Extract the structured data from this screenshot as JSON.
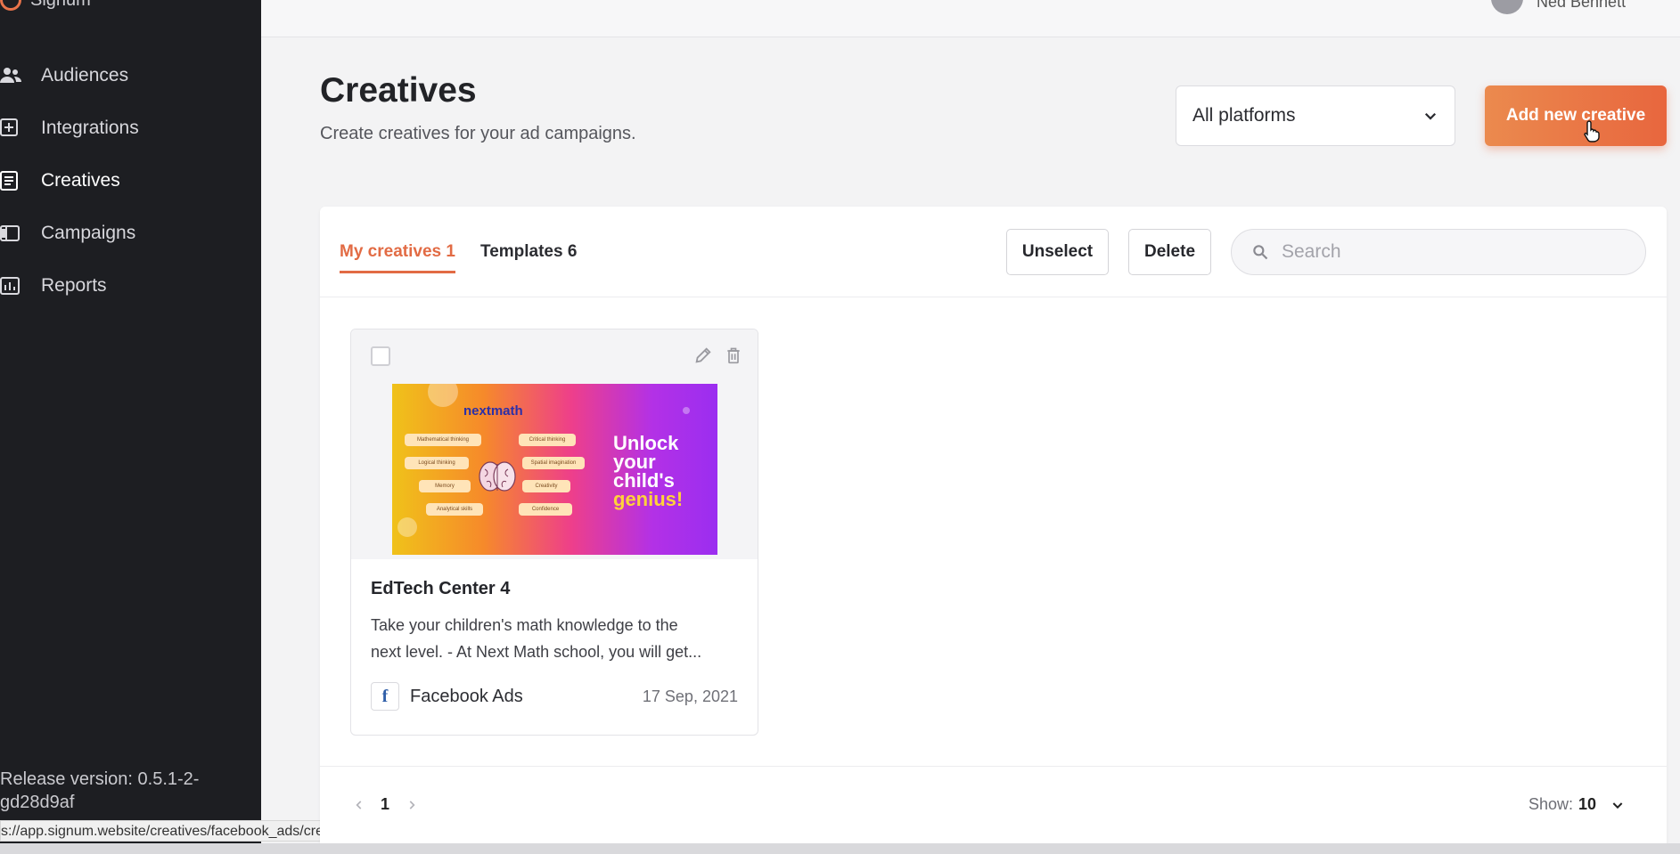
{
  "app": {
    "logo_text": "Signum"
  },
  "sidebar": {
    "items": [
      {
        "label": "Audiences",
        "icon": "users-icon"
      },
      {
        "label": "Integrations",
        "icon": "plus-square-icon"
      },
      {
        "label": "Creatives",
        "icon": "document-list-icon",
        "active": true
      },
      {
        "label": "Campaigns",
        "icon": "layout-icon"
      },
      {
        "label": "Reports",
        "icon": "bar-chart-icon"
      }
    ],
    "release_version": "Release version: 0.5.1-2-gd28d9af"
  },
  "status_bar": {
    "url": "s://app.signum.website/creatives/facebook_ads/create"
  },
  "topbar": {
    "user_name": "Ned Bennett"
  },
  "header": {
    "title": "Creatives",
    "subtitle": "Create creatives for your ad campaigns.",
    "platform_select_value": "All platforms",
    "add_button_label": "Add new creative"
  },
  "panel": {
    "tabs": [
      {
        "label": "My creatives 1",
        "active": true
      },
      {
        "label": "Templates 6",
        "active": false
      }
    ],
    "unselect_label": "Unselect",
    "delete_label": "Delete",
    "search_placeholder": "Search"
  },
  "creative_card": {
    "thumbnail": {
      "brand": "nextmath",
      "headline_line1": "Unlock",
      "headline_line2": "your",
      "headline_line3": "child's",
      "headline_line4": "genius!",
      "pills": [
        "Mathematical thinking",
        "Logical thinking",
        "Memory",
        "Analytical skills",
        "Critical thinking",
        "Spatial imagination",
        "Creativity",
        "Confidence"
      ]
    },
    "title": "EdTech Center 4",
    "description_line1": "Take your children's math knowledge to the",
    "description_line2": "next level. - At Next Math school, you will get...",
    "platform": "Facebook Ads",
    "platform_icon": "facebook-icon",
    "date": "17 Sep, 2021"
  },
  "pagination": {
    "current_page": "1",
    "show_label": "Show:",
    "show_value": "10"
  },
  "colors": {
    "sidebar_bg": "#1d1e22",
    "accent": "#e26b44",
    "button_gradient_start": "#eb8a4e",
    "button_gradient_end": "#e8663e",
    "facebook_blue": "#2f5ea8"
  }
}
